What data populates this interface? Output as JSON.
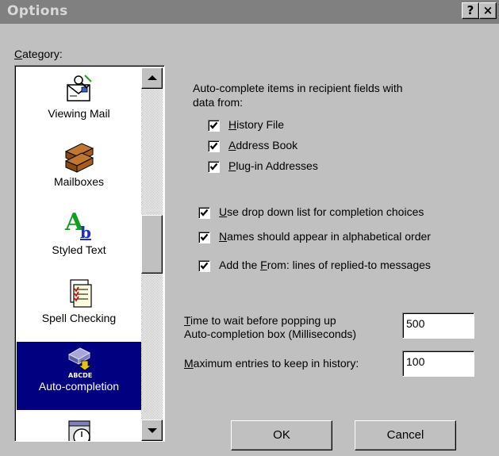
{
  "window": {
    "title": "Options",
    "help_glyph": "?",
    "close_glyph": "×"
  },
  "category": {
    "label_prefix": "C",
    "label_rest": "ategory:",
    "selected": "Auto-completion",
    "items": [
      {
        "label": "Viewing Mail",
        "icon": "viewing-mail-icon"
      },
      {
        "label": "Mailboxes",
        "icon": "mailboxes-icon"
      },
      {
        "label": "Styled Text",
        "icon": "styled-text-icon"
      },
      {
        "label": "Spell Checking",
        "icon": "spell-checking-icon"
      },
      {
        "label": "Auto-completion",
        "icon": "auto-completion-icon"
      },
      {
        "label": "",
        "icon": "clock-icon"
      }
    ],
    "styled_icon_letters": {
      "big": "A",
      "small": "b"
    },
    "autocomplete_icon_text": "ABCDE"
  },
  "autocomplete": {
    "intro_line1": "Auto-complete items in recipient fields with",
    "intro_line2": "data from:",
    "sources": [
      {
        "accel": "H",
        "rest": "istory File",
        "checked": true
      },
      {
        "accel": "A",
        "rest": "ddress Book",
        "checked": true
      },
      {
        "accel": "P",
        "rest": "lug-in Addresses",
        "checked": true
      }
    ],
    "options": [
      {
        "accel": "U",
        "rest": "se drop down list for completion choices",
        "checked": true
      },
      {
        "accel": "N",
        "rest": "ames should appear in alphabetical order",
        "checked": true
      },
      {
        "pre": "Add the ",
        "accel": "F",
        "rest": "rom: lines of replied-to messages",
        "checked": true
      }
    ]
  },
  "timing": {
    "wait_accel": "T",
    "wait_line1_rest": "ime to wait before popping up",
    "wait_line2": "Auto-completion box (Milliseconds)",
    "wait_value": "500",
    "max_accel": "M",
    "max_rest": "aximum entries to keep in history:",
    "max_value": "100"
  },
  "buttons": {
    "ok": "OK",
    "cancel": "Cancel"
  },
  "colors": {
    "titlebar": "#808080",
    "face": "#c0c0c0",
    "selection": "#000080"
  }
}
